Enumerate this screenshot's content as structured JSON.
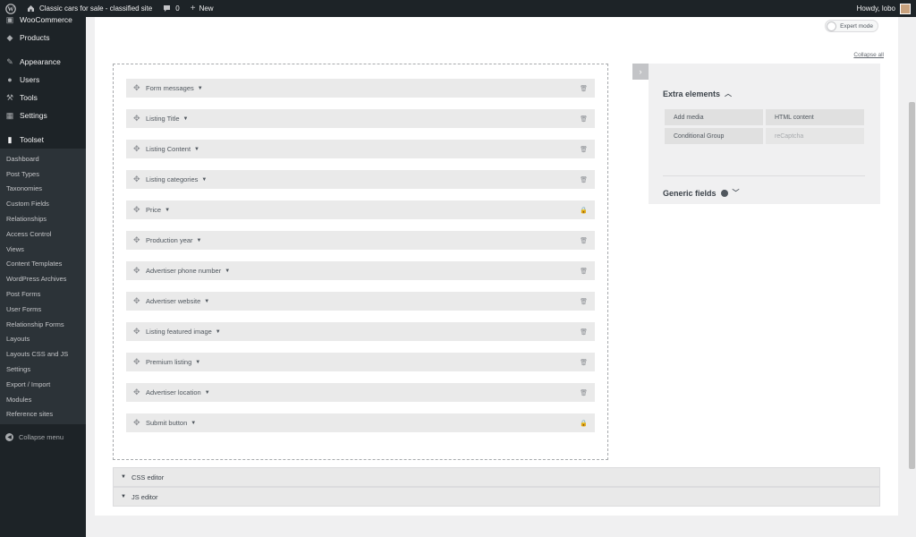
{
  "adminbar": {
    "wp_icon": "wordpress-icon",
    "site_name": "Classic cars for sale - classified site",
    "comments_count": "0",
    "new_label": "New",
    "howdy": "Howdy, lobo"
  },
  "sidebar": {
    "top_items": [
      {
        "label": "WooCommerce",
        "icon": "woocommerce-icon"
      },
      {
        "label": "Products",
        "icon": "products-icon"
      },
      {
        "label": "Appearance",
        "icon": "appearance-icon"
      },
      {
        "label": "Users",
        "icon": "users-icon"
      },
      {
        "label": "Tools",
        "icon": "tools-icon"
      },
      {
        "label": "Settings",
        "icon": "settings-icon"
      },
      {
        "label": "Toolset",
        "icon": "toolset-icon"
      }
    ],
    "submenu": [
      "Dashboard",
      "Post Types",
      "Taxonomies",
      "Custom Fields",
      "Relationships",
      "Access Control",
      "Views",
      "Content Templates",
      "WordPress Archives",
      "Post Forms",
      "User Forms",
      "Relationship Forms",
      "Layouts",
      "Layouts CSS and JS",
      "Settings",
      "Export / Import",
      "Modules",
      "Reference sites"
    ],
    "collapse_label": "Collapse menu"
  },
  "editor": {
    "expert_mode": "Expert mode",
    "collapse_all": "Collapse all",
    "fields": [
      {
        "label": "Form messages",
        "icon": "trash-icon"
      },
      {
        "label": "Listing Title",
        "icon": "trash-icon"
      },
      {
        "label": "Listing Content",
        "icon": "trash-icon"
      },
      {
        "label": "Listing categories",
        "icon": "trash-icon"
      },
      {
        "label": "Price",
        "icon": "lock-icon"
      },
      {
        "label": "Production year",
        "icon": "trash-icon"
      },
      {
        "label": "Advertiser phone number",
        "icon": "trash-icon"
      },
      {
        "label": "Advertiser website",
        "icon": "trash-icon"
      },
      {
        "label": "Listing featured image",
        "icon": "trash-icon"
      },
      {
        "label": "Premium listing",
        "icon": "trash-icon"
      },
      {
        "label": "Advertiser location",
        "icon": "trash-icon"
      },
      {
        "label": "Submit button",
        "icon": "lock-icon"
      }
    ],
    "extra_elements_title": "Extra elements",
    "extra_buttons": [
      "Add media",
      "HTML content",
      "Conditional Group",
      "reCaptcha"
    ],
    "generic_fields_title": "Generic fields",
    "css_editor": "CSS editor",
    "js_editor": "JS editor"
  }
}
